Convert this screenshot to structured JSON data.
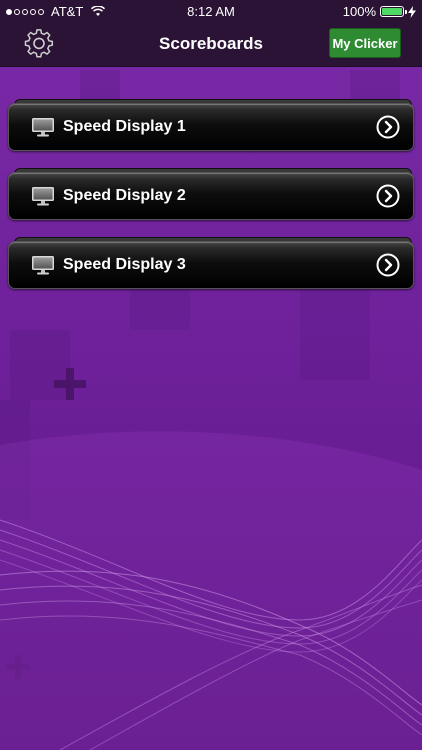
{
  "status_bar": {
    "carrier": "AT&T",
    "time": "8:12 AM",
    "battery_percent": "100%",
    "battery_level": 1.0,
    "battery_color": "#4cd964",
    "signal_bars_filled": 1,
    "signal_bars_total": 5
  },
  "nav": {
    "title": "Scoreboards",
    "settings_icon": "gear-icon",
    "clicker_label": "My Clicker",
    "clicker_color": "#2e8b32"
  },
  "scoreboards": [
    {
      "label": "Speed Display 1",
      "icon": "monitor-icon",
      "accessory": "chevron-right-circle-icon"
    },
    {
      "label": "Speed Display 2",
      "icon": "monitor-icon",
      "accessory": "chevron-right-circle-icon"
    },
    {
      "label": "Speed Display 3",
      "icon": "monitor-icon",
      "accessory": "chevron-right-circle-icon"
    }
  ],
  "theme": {
    "background": "#6a1f91",
    "bar": "#2b1336"
  }
}
